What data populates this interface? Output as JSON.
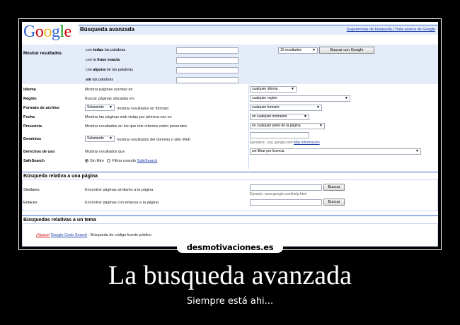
{
  "header": {
    "logo": "Google",
    "title": "Búsqueda avanzada",
    "links": "Sugerencias de búsqueda | Toda acerca de Google"
  },
  "colors": {
    "blue": "#3366cc",
    "red": "#cc0000",
    "yellow": "#eeb211",
    "green": "#109618",
    "panel": "#e5ecf9"
  },
  "main": {
    "label": "Mostrar resultados",
    "rows": [
      {
        "pre": "con ",
        "bold": "todas",
        "post": " las palabras"
      },
      {
        "pre": "con la ",
        "bold": "frase exacta",
        "post": ""
      },
      {
        "pre": "con ",
        "bold": "alguna",
        "post": " de las palabras"
      },
      {
        "pre": "",
        "bold": "sin",
        "post": " las palabras"
      }
    ],
    "results_select": "10 resultados",
    "search_button": "Buscar con Google"
  },
  "options": [
    {
      "label": "Idioma",
      "desc": "Mostrar páginas escritas en",
      "select": "cualquier idioma"
    },
    {
      "label": "Región",
      "desc": "Buscar páginas ubicadas en:",
      "select": "cualquier región"
    },
    {
      "label": "Formato de archivo",
      "desc_select": "Solamente",
      "desc": "mostrar resultados en formato",
      "select": "cualquier formato"
    },
    {
      "label": "Fecha",
      "desc": "Mostrar las páginas web vistas por primera vez en",
      "select": "en cualquier momento"
    },
    {
      "label": "Presencia",
      "desc": "Mostrar resultados en los que mis criterios estén presentes",
      "select": "en cualquier parte de la página"
    },
    {
      "label": "Dominios",
      "desc_select": "Solamente",
      "desc": "mostrar resultados del dominio o sitio Web",
      "hint": "Ejemplos: .org, google.com",
      "hint_link": "Más información"
    },
    {
      "label": "Derechos de uso",
      "desc": "Mostrar resultados que",
      "select": "sin filtrar por licencia"
    },
    {
      "label": "SafeSearch",
      "radio_on": "Sin filtro",
      "radio_off": "Filtrar usando",
      "radio_link": "SafeSearch"
    }
  ],
  "section2": {
    "title": "Búsqueda relativa a una página",
    "rows": [
      {
        "label": "Similares",
        "desc": "Encontrar páginas similares a la página",
        "button": "Buscar",
        "hint": "Ejemplo: www.google.com/help.html"
      },
      {
        "label": "Enlaces",
        "desc": "Encontrar páginas con enlaces a la página",
        "button": "Buscar"
      }
    ]
  },
  "section3": {
    "title": "Búsquedas relativas a un tema",
    "new": "¡Nuevo!",
    "link": "Google Code Search",
    "text": " - Búsqueda de código fuente público"
  },
  "watermark": "desmotivaciones.es",
  "poster": {
    "title": "La busqueda avanzada",
    "subtitle": "Siempre está ahi..."
  }
}
